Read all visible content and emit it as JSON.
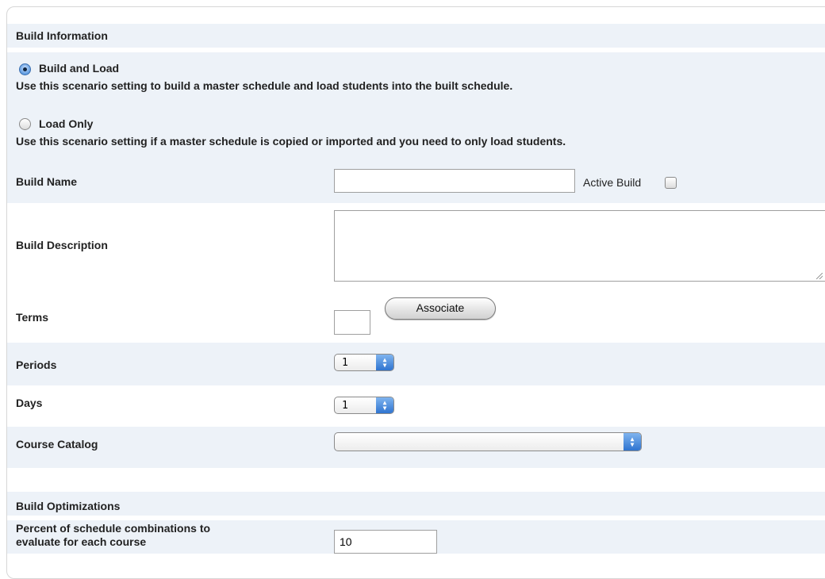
{
  "sections": {
    "build_information": "Build Information",
    "build_optimizations": "Build Optimizations"
  },
  "scenario": {
    "build_and_load": {
      "label": "Build and Load",
      "description": "Use this scenario setting to build a master schedule and load students into the built schedule.",
      "selected": true
    },
    "load_only": {
      "label": "Load Only",
      "description": "Use this scenario setting if a master schedule is copied or imported and you need to only load students.",
      "selected": false
    }
  },
  "fields": {
    "build_name": {
      "label": "Build Name",
      "value": ""
    },
    "active_build": {
      "label": "Active Build",
      "checked": false
    },
    "build_description": {
      "label": "Build Description",
      "value": ""
    },
    "terms": {
      "label": "Terms",
      "value": "",
      "associate_label": "Associate"
    },
    "periods": {
      "label": "Periods",
      "value": "1"
    },
    "days": {
      "label": "Days",
      "value": "1"
    },
    "course_catalog": {
      "label": "Course Catalog",
      "value": ""
    },
    "percent_combinations": {
      "label_line1": "Percent of schedule combinations to",
      "label_line2": "evaluate for each course",
      "value": "10"
    }
  }
}
